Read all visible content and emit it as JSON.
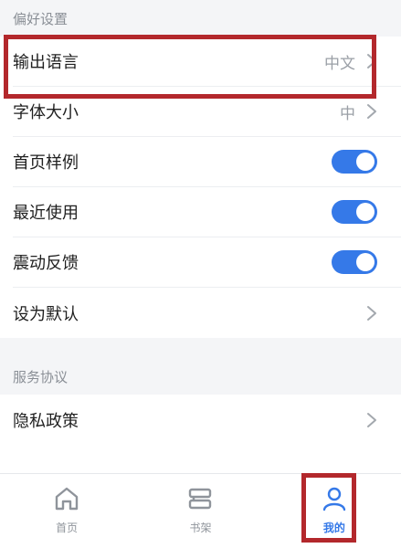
{
  "preferences": {
    "header": "偏好设置",
    "items": [
      {
        "label": "输出语言",
        "value": "中文",
        "control": "chevron"
      },
      {
        "label": "字体大小",
        "value": "中",
        "control": "chevron"
      },
      {
        "label": "首页样例",
        "control": "toggle",
        "on": true
      },
      {
        "label": "最近使用",
        "control": "toggle",
        "on": true
      },
      {
        "label": "震动反馈",
        "control": "toggle",
        "on": true
      },
      {
        "label": "设为默认",
        "control": "chevron"
      }
    ]
  },
  "service": {
    "header": "服务协议",
    "items": [
      {
        "label": "隐私政策",
        "control": "chevron"
      }
    ]
  },
  "tabbar": {
    "tabs": [
      {
        "label": "首页",
        "icon": "home-icon",
        "active": false
      },
      {
        "label": "书架",
        "icon": "bookshelf-icon",
        "active": false
      },
      {
        "label": "我的",
        "icon": "profile-icon",
        "active": true
      }
    ]
  },
  "colors": {
    "accent": "#3579e8",
    "highlight": "#b3282c"
  }
}
